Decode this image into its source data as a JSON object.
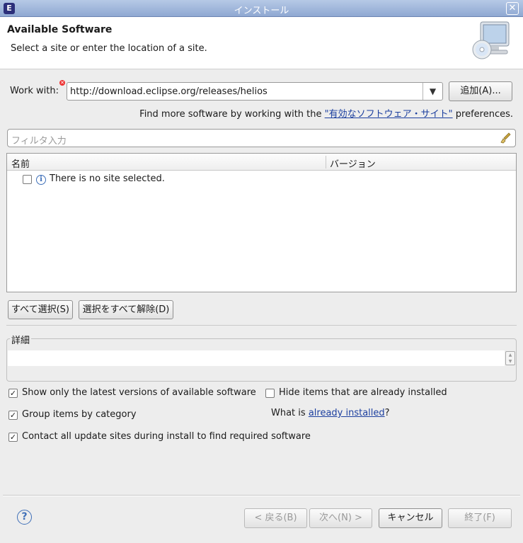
{
  "window": {
    "title": "インストール",
    "close_glyph": "✕",
    "app_icon_glyph": "E"
  },
  "banner": {
    "heading": "Available Software",
    "subheading": "Select a site or enter the location of a site.",
    "icon": "monitor-cd-icon"
  },
  "work_with": {
    "label": "Work with:",
    "value": "http://download.eclipse.org/releases/helios",
    "add_button": "追加(A)...",
    "find_more_prefix": "Find more software by working with the ",
    "find_more_link": "\"有効なソフトウェア・サイト\"",
    "find_more_suffix": " preferences."
  },
  "filter": {
    "placeholder": "フィルタ入力"
  },
  "table": {
    "columns": [
      "名前",
      "バージョン"
    ],
    "rows": [
      {
        "name": "There is no site selected.",
        "checked": false,
        "icon": "info-icon"
      }
    ]
  },
  "selection_buttons": {
    "select_all": "すべて選択(S)",
    "deselect_all": "選択をすべて解除(D)"
  },
  "details": {
    "label": "詳細",
    "value": ""
  },
  "options": {
    "latest_versions": {
      "label": "Show only the latest versions of available software",
      "checked": true
    },
    "hide_installed": {
      "label": "Hide items that are already installed",
      "checked": false
    },
    "group_by_category": {
      "label": "Group items by category",
      "checked": true
    },
    "what_is_prefix": "What is ",
    "what_is_link": "already installed",
    "what_is_suffix": "?",
    "contact_all": {
      "label": "Contact all update sites during install to find required software",
      "checked": true
    }
  },
  "footer": {
    "help": "?",
    "back": "< 戻る(B)",
    "next": "次へ(N) >",
    "cancel": "キャンセル",
    "finish": "終了(F)"
  },
  "colors": {
    "link": "#1c3f9f",
    "titlebar": "#8fa8d2"
  }
}
